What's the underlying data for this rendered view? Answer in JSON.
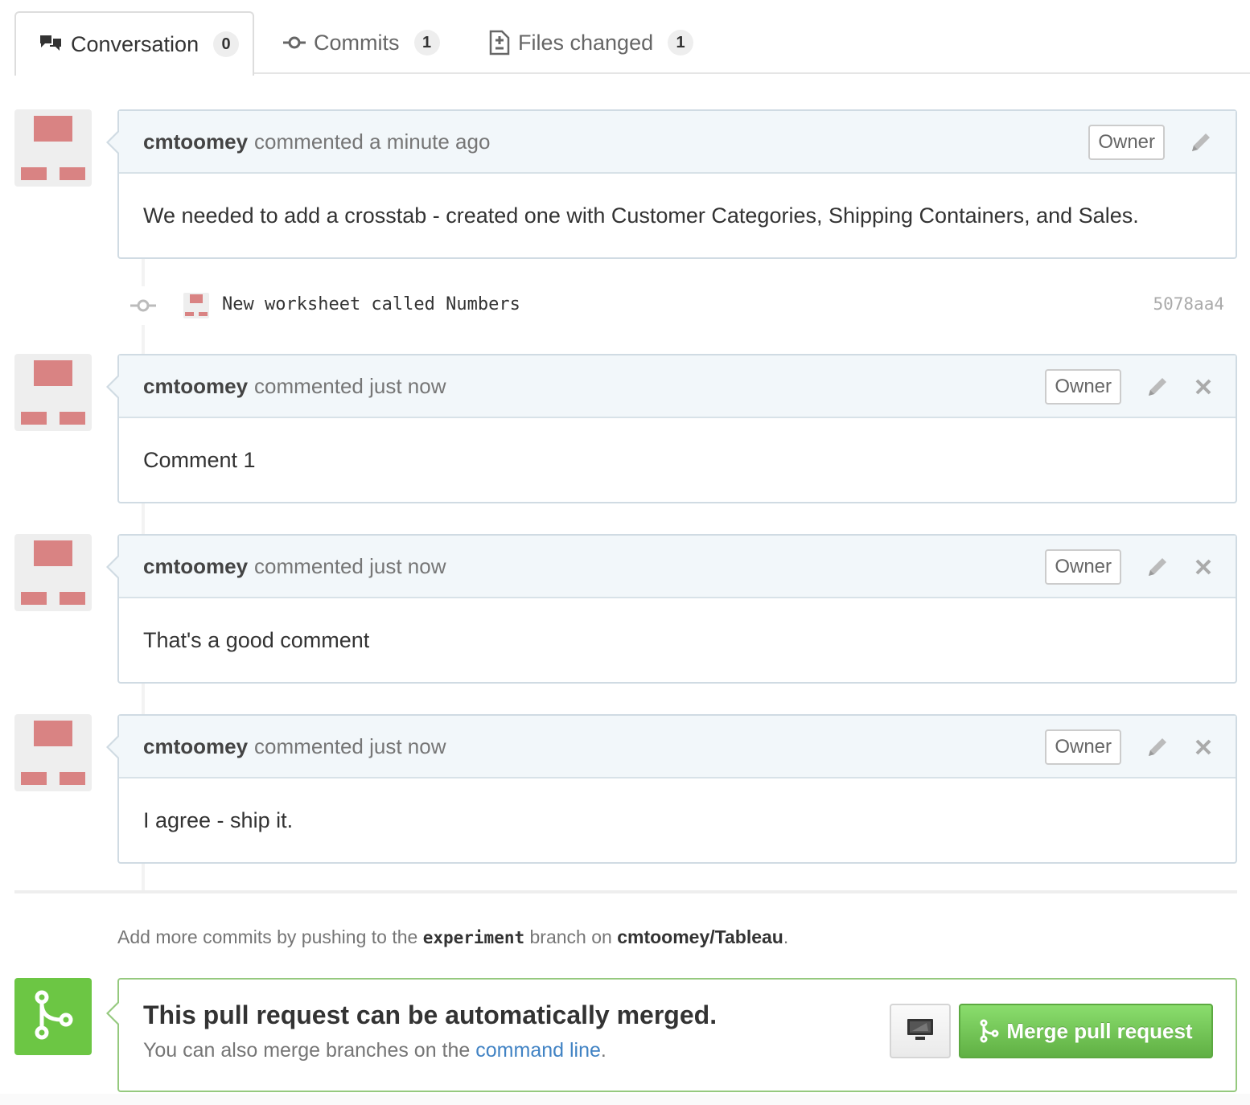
{
  "tabs": [
    {
      "label": "Conversation",
      "count": "0",
      "icon": "comment-discussion-icon",
      "active": true
    },
    {
      "label": "Commits",
      "count": "1",
      "icon": "git-commit-icon",
      "active": false
    },
    {
      "label": "Files changed",
      "count": "1",
      "icon": "file-diff-icon",
      "active": false
    }
  ],
  "comments": [
    {
      "author": "cmtoomey",
      "action": "commented a minute ago",
      "badge": "Owner",
      "body": "We needed to add a crosstab - created one with Customer Categories, Shipping Containers, and Sales.",
      "can_delete": false
    },
    {
      "author": "cmtoomey",
      "action": "commented just now",
      "badge": "Owner",
      "body": "Comment 1",
      "can_delete": true
    },
    {
      "author": "cmtoomey",
      "action": "commented just now",
      "badge": "Owner",
      "body": "That's a good comment",
      "can_delete": true
    },
    {
      "author": "cmtoomey",
      "action": "commented just now",
      "badge": "Owner",
      "body": "I agree - ship it.",
      "can_delete": true
    }
  ],
  "commit": {
    "message": "New worksheet called Numbers",
    "sha": "5078aa4"
  },
  "branch_note": {
    "prefix": "Add more commits by pushing to the",
    "branch": "experiment",
    "middle": "branch on",
    "repo": "cmtoomey/Tableau",
    "suffix": "."
  },
  "merge": {
    "title": "This pull request can be automatically merged.",
    "sub_prefix": "You can also merge branches on the",
    "sub_link": "command line",
    "sub_suffix": ".",
    "button_label": "Merge pull request",
    "accent_color": "#6cc644"
  }
}
